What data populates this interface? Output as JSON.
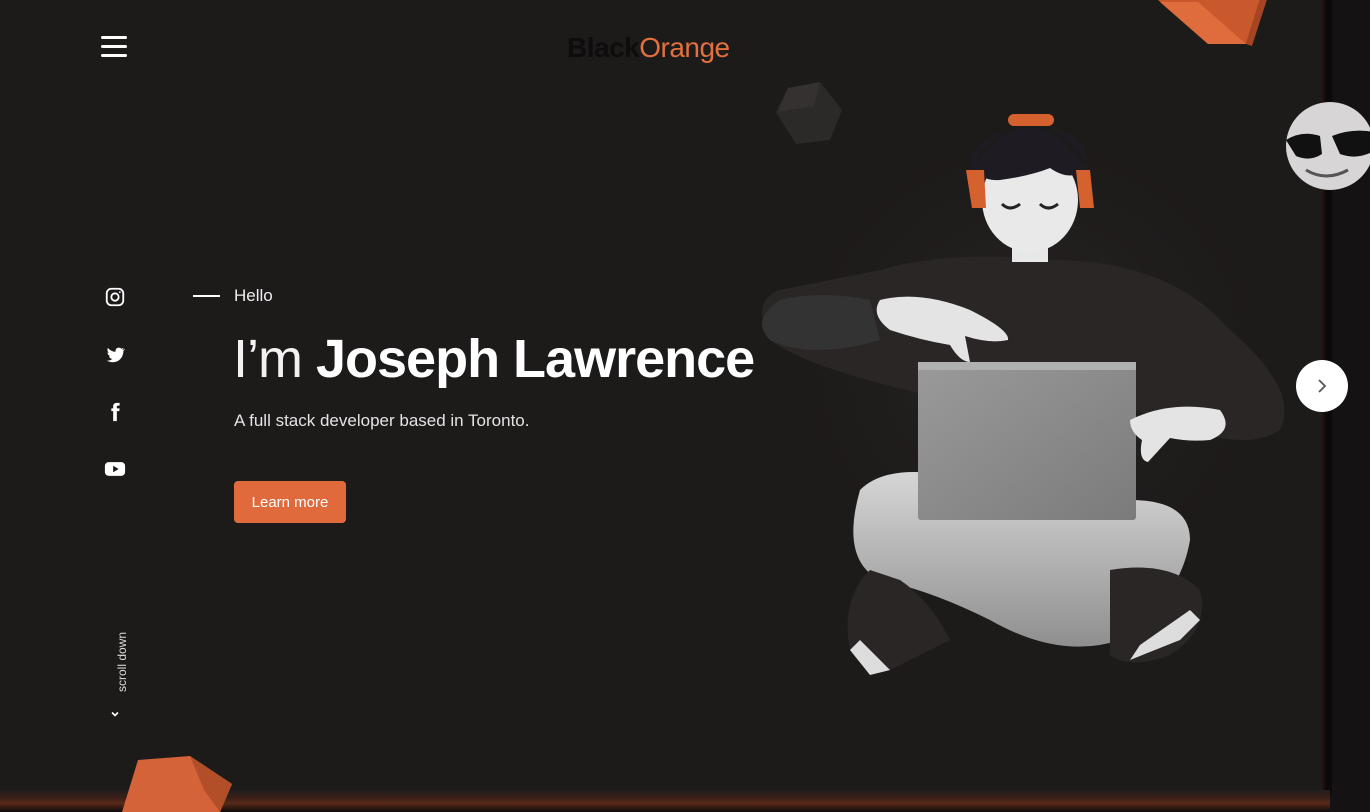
{
  "header": {
    "logo_black": "Black",
    "logo_orange": "Orange",
    "menu_icon": "hamburger-icon"
  },
  "social": [
    {
      "name": "instagram",
      "icon": "instagram-icon"
    },
    {
      "name": "twitter",
      "icon": "twitter-icon"
    },
    {
      "name": "facebook",
      "icon": "facebook-icon"
    },
    {
      "name": "youtube",
      "icon": "youtube-icon"
    }
  ],
  "hero": {
    "greeting": "Hello",
    "headline_prefix": "I’m",
    "headline_name": "Joseph Lawrence",
    "subline": "A full stack developer based in Toronto.",
    "cta_label": "Learn more"
  },
  "scroll": {
    "label": "scroll down",
    "icon": "chevron-down-icon"
  },
  "carousel": {
    "next_icon": "chevron-right-icon"
  },
  "colors": {
    "background": "#1d1a1a",
    "accent": "#e06a3c",
    "logo_dark": "#0e0c0c"
  }
}
